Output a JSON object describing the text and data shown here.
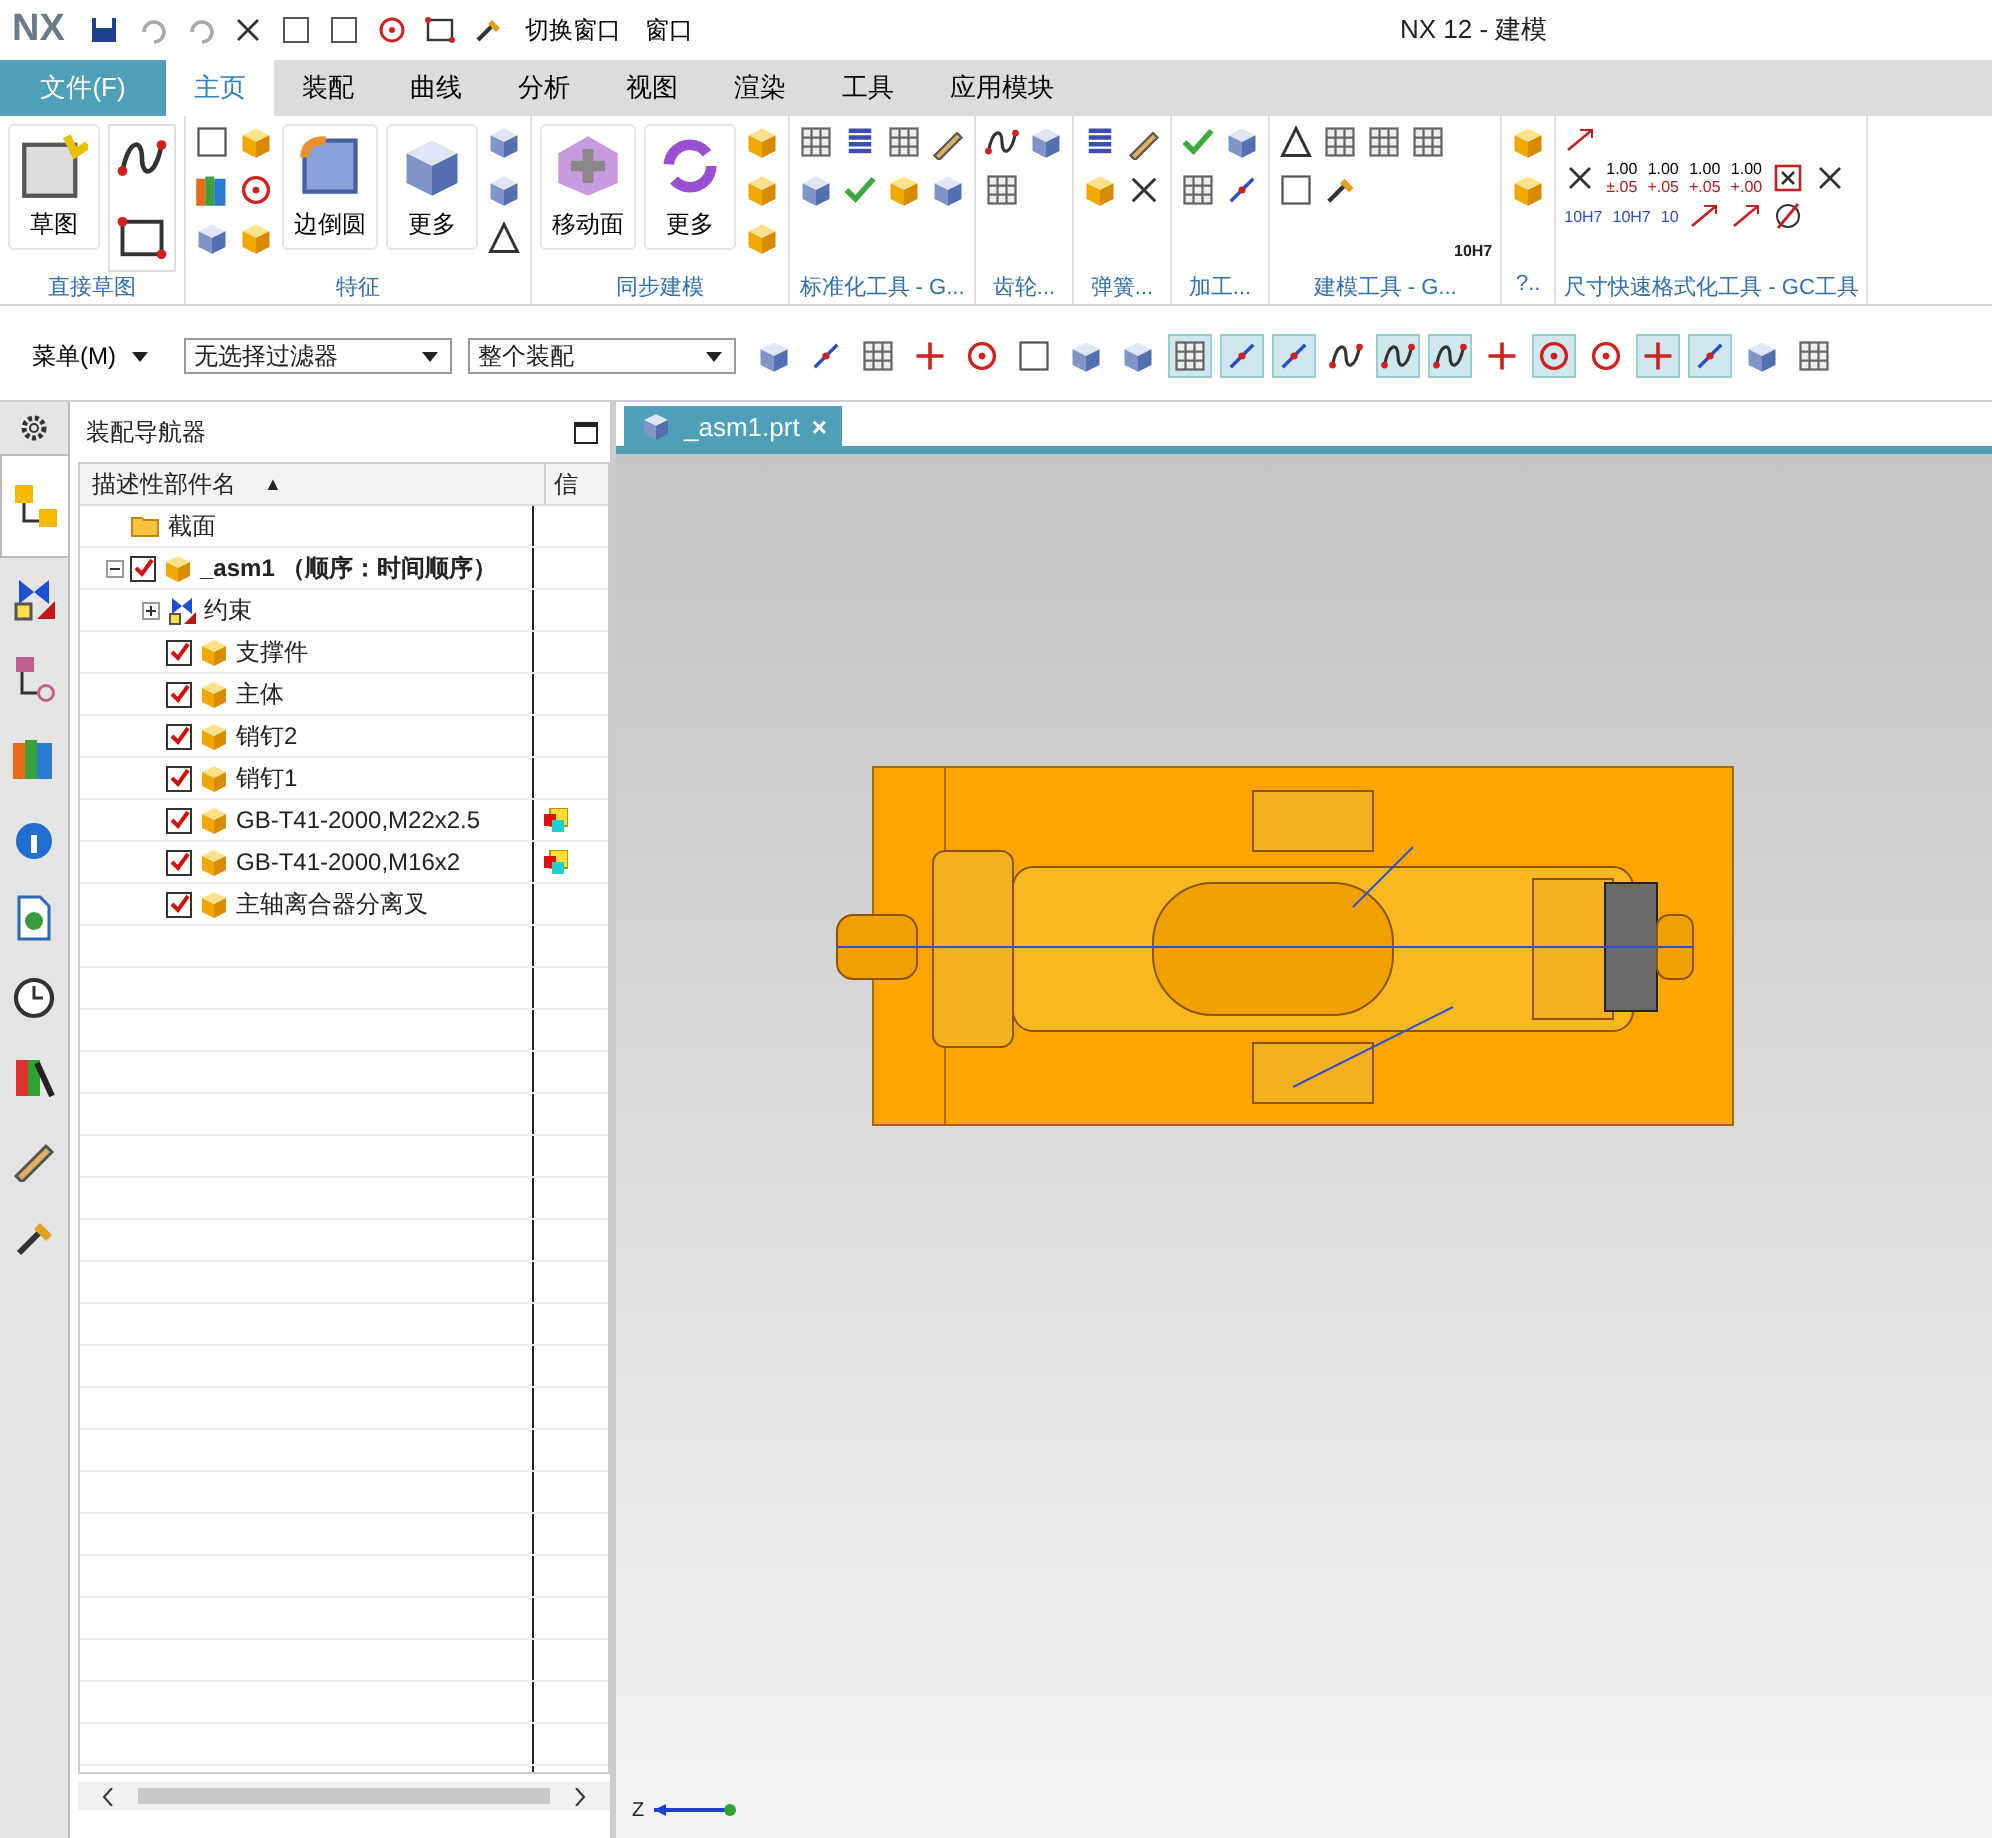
{
  "title_bar": {
    "logo": "NX",
    "switch_window": "切换窗口",
    "window_menu": "窗口",
    "title": "NX 12 - 建模"
  },
  "file_button": "文件(F)",
  "tabs": [
    {
      "label": "主页",
      "selected": true
    },
    {
      "label": "装配",
      "selected": false
    },
    {
      "label": "曲线",
      "selected": false
    },
    {
      "label": "分析",
      "selected": false
    },
    {
      "label": "视图",
      "selected": false
    },
    {
      "label": "渲染",
      "selected": false
    },
    {
      "label": "工具",
      "selected": false
    },
    {
      "label": "应用模块",
      "selected": false
    }
  ],
  "ribbon": [
    {
      "label": "直接草图",
      "buttons": [
        "草图"
      ]
    },
    {
      "label": "特征",
      "buttons": [
        "边倒圆",
        "更多"
      ]
    },
    {
      "label": "同步建模",
      "buttons": [
        "移动面",
        "更多"
      ]
    },
    {
      "label": "标准化工具 - G..."
    },
    {
      "label": "齿轮..."
    },
    {
      "label": "弹簧..."
    },
    {
      "label": "加工..."
    },
    {
      "label": "建模工具 - G...",
      "caption": "10H7"
    },
    {
      "label": "?.."
    },
    {
      "label": "尺寸快速格式化工具 - GC工具",
      "tolerances": [
        {
          "value": "1.00",
          "tol": "±.05"
        },
        {
          "value": "1.00",
          "tol": "+.05"
        },
        {
          "value": "1.00",
          "tol": "+.05"
        },
        {
          "value": "1.00",
          "tol": "+.00"
        }
      ],
      "fits": [
        "10H7",
        "10H7",
        "10"
      ]
    }
  ],
  "toolbar": {
    "menu": "菜单(M)",
    "filter": "无选择过滤器",
    "scope": "整个装配"
  },
  "resource_bar": [
    {
      "kind": "settings",
      "selected": false
    },
    {
      "kind": "assembly",
      "selected": true
    },
    {
      "kind": "constraints",
      "selected": false
    },
    {
      "kind": "part",
      "selected": false
    },
    {
      "kind": "library",
      "selected": false
    },
    {
      "kind": "info",
      "selected": false
    },
    {
      "kind": "web",
      "selected": false
    },
    {
      "kind": "history",
      "selected": false
    },
    {
      "kind": "palette",
      "selected": false
    },
    {
      "kind": "roles",
      "selected": false
    },
    {
      "kind": "tools",
      "selected": false
    }
  ],
  "navigator": {
    "title": "装配导航器",
    "columns": [
      "描述性部件名",
      "信"
    ],
    "sort_mark": "▲",
    "tree": [
      {
        "label": "截面",
        "kind": "folder"
      },
      {
        "label": "_asm1 （顺序：时间顺序）",
        "kind": "assembly",
        "checked": true,
        "expanded": true,
        "children": [
          {
            "label": "约束",
            "kind": "constraints",
            "expanded": false
          },
          {
            "label": "支撑件",
            "kind": "part",
            "checked": true,
            "info": false
          },
          {
            "label": "主体",
            "kind": "part",
            "checked": true,
            "info": false
          },
          {
            "label": "销钉2",
            "kind": "part",
            "checked": true,
            "info": false
          },
          {
            "label": "销钉1",
            "kind": "part",
            "checked": true,
            "info": false
          },
          {
            "label": "GB-T41-2000,M22x2.5",
            "kind": "part",
            "checked": true,
            "info": true
          },
          {
            "label": "GB-T41-2000,M16x2",
            "kind": "part",
            "checked": true,
            "info": true
          },
          {
            "label": "主轴离合器分离叉",
            "kind": "part",
            "checked": true,
            "info": false
          }
        ]
      }
    ]
  },
  "viewport": {
    "tab": "_asm1.prt",
    "close": "×",
    "axis": "Z"
  }
}
